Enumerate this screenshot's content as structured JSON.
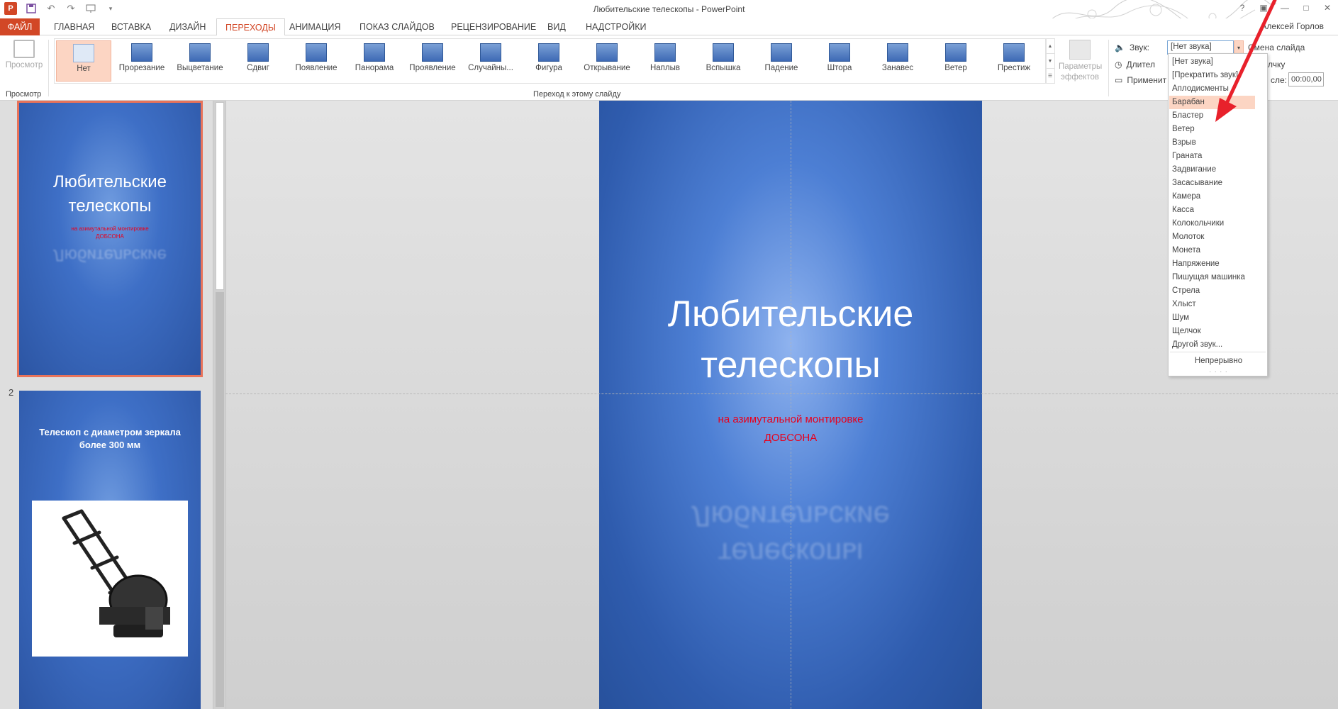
{
  "window": {
    "title": "Любительские телескопы - PowerPoint",
    "user": "Алексей Горлов"
  },
  "ribbon_tabs": [
    "ФАЙЛ",
    "ГЛАВНАЯ",
    "ВСТАВКА",
    "ДИЗАЙН",
    "ПЕРЕХОДЫ",
    "АНИМАЦИЯ",
    "ПОКАЗ СЛАЙДОВ",
    "РЕЦЕНЗИРОВАНИЕ",
    "ВИД",
    "НАДСТРОЙКИ"
  ],
  "active_tab": "ПЕРЕХОДЫ",
  "preview": {
    "button_label": "Просмотр",
    "group_label": "Просмотр"
  },
  "transitions": {
    "group_label": "Переход к этому слайду",
    "items": [
      "Нет",
      "Прорезание",
      "Выцветание",
      "Сдвиг",
      "Появление",
      "Панорама",
      "Проявление",
      "Случайны...",
      "Фигура",
      "Открывание",
      "Наплыв",
      "Вспышка",
      "Падение",
      "Штора",
      "Занавес",
      "Ветер",
      "Престиж"
    ],
    "selected": "Нет",
    "effect_params_line1": "Параметры",
    "effect_params_line2": "эффектов"
  },
  "timing": {
    "sound_label": "Звук:",
    "sound_value": "[Нет звука]",
    "duration_label": "Длител",
    "apply_label": "Применит",
    "change_slide_label": "Смена слайда",
    "on_click_label": "щелчку",
    "after_label": "сле:",
    "after_value": "00:00,00"
  },
  "sound_dropdown": {
    "items": [
      "[Нет звука]",
      "[Прекратить звук]",
      "Аплодисменты",
      "Барабан",
      "Бластер",
      "Ветер",
      "Взрыв",
      "Граната",
      "Задвигание",
      "Засасывание",
      "Камера",
      "Касса",
      "Колокольчики",
      "Молоток",
      "Монета",
      "Напряжение",
      "Пишущая машинка",
      "Стрела",
      "Хлыст",
      "Шум",
      "Щелчок",
      "Другой звук..."
    ],
    "hovered": "Барабан",
    "loop_option": "Непрерывно"
  },
  "thumbnails": {
    "slide1": {
      "title": "Любительские телескопы",
      "subtitle": "на азимутальной монтировке ДОБСОНА",
      "reflection": "Любительские"
    },
    "slide2": {
      "number": "2",
      "title": "Телескоп с диаметром зеркала более 300 мм"
    }
  },
  "main_slide": {
    "title_line1": "Любительские",
    "title_line2": "телескопы",
    "subtitle_line1": "на  азимутальной монтировке",
    "subtitle_line2": "ДОБСОНА",
    "reflection_line1": "телескопы",
    "reflection_line2": "Любительские"
  },
  "colors": {
    "accent": "#d24726",
    "selected_bg": "#fcd5c3",
    "slide_blue": "#3e6fc6",
    "subtitle_red": "#e8001c",
    "annotation_arrow": "#e8212b"
  }
}
